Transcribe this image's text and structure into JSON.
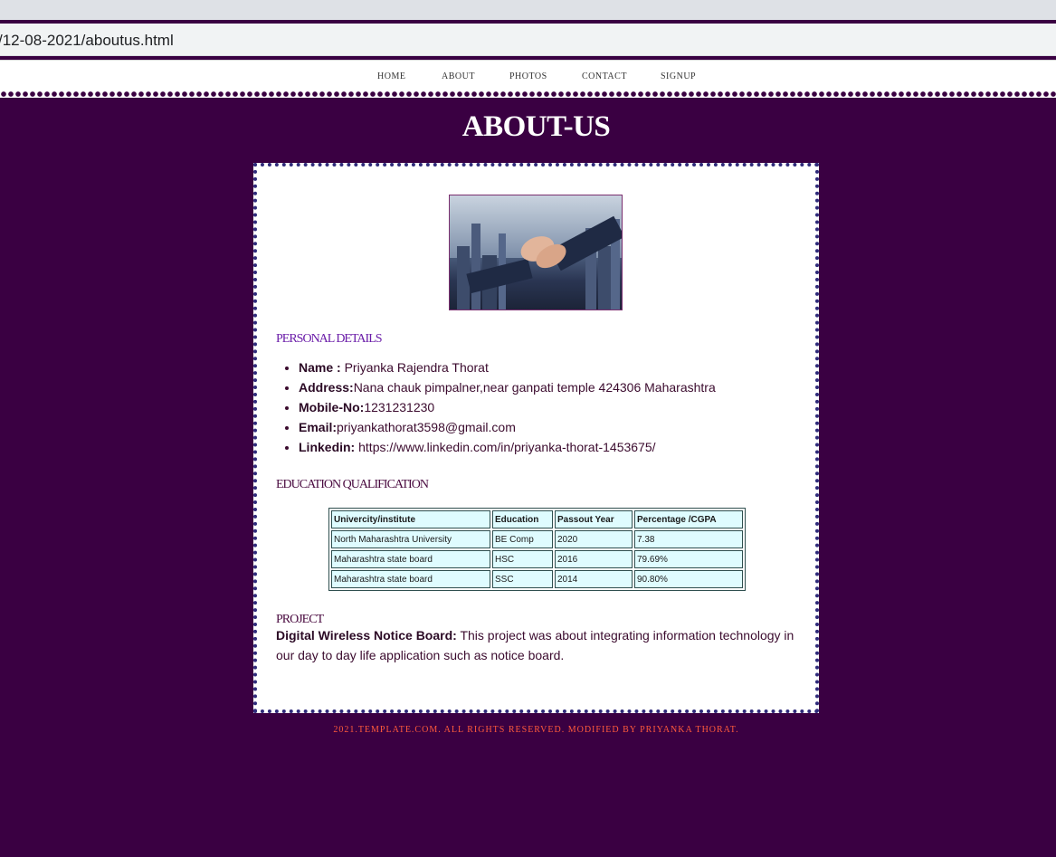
{
  "browser": {
    "url": "/12-08-2021/aboutus.html"
  },
  "nav": {
    "items": [
      "HOME",
      "ABOUT",
      "PHOTOS",
      "CONTACT",
      "SIGNUP"
    ]
  },
  "page_title": "ABOUT-US",
  "personal": {
    "heading": "PERSONAL DETAILS",
    "items": [
      {
        "label": "Name :",
        "value": " Priyanka Rajendra Thorat"
      },
      {
        "label": "Address:",
        "value": "Nana chauk pimpalner,near ganpati temple 424306 Maharashtra"
      },
      {
        "label": "Mobile-No:",
        "value": "1231231230"
      },
      {
        "label": "Email:",
        "value": "priyankathorat3598@gmail.com"
      },
      {
        "label": "Linkedin:",
        "value": " https://www.linkedin.com/in/priyanka-thorat-1453675/"
      }
    ]
  },
  "education": {
    "heading": "EDUCATION QUALIFICATION",
    "columns": [
      "Univercity/institute",
      "Education",
      "Passout Year",
      "Percentage /CGPA"
    ],
    "rows": [
      [
        "North Maharashtra University",
        "BE Comp",
        "2020",
        "7.38"
      ],
      [
        "Maharashtra state board",
        "HSC",
        "2016",
        "79.69%"
      ],
      [
        "Maharashtra state board",
        "SSC",
        "2014",
        "90.80%"
      ]
    ]
  },
  "project": {
    "heading": "PROJECT",
    "title": "Digital Wireless Notice Board:",
    "description": " This project was about integrating information technology in our day to day life application such as notice board."
  },
  "footer": "2021.TEMPLATE.COM. ALL RIGHTS RESERVED. MODIFIED BY PRIYANKA THORAT.",
  "colors": {
    "background": "#3a0042",
    "card": "#ffffff",
    "table_cell": "#dffcff",
    "footer_text": "#ff5a3c"
  }
}
